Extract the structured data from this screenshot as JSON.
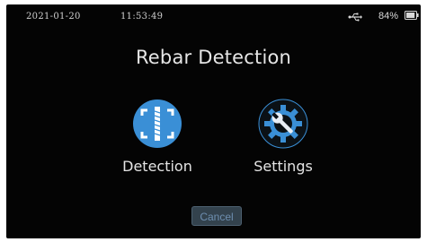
{
  "status_bar": {
    "date": "2021-01-20",
    "time": "11:53:49",
    "battery_percent": "84%",
    "usb_icon": "usb-icon",
    "battery_icon": "battery-icon",
    "battery_level": 0.84
  },
  "main": {
    "title": "Rebar Detection",
    "items": [
      {
        "label": "Detection",
        "icon": "rebar-scan-icon",
        "color": "#3a8fd6"
      },
      {
        "label": "Settings",
        "icon": "gear-wrench-icon",
        "color": "#3a8fd6"
      }
    ]
  },
  "footer": {
    "cancel_label": "Cancel"
  },
  "colors": {
    "screen_background": "#040404",
    "accent": "#3a8fd6",
    "cancel_bg": "#33424d",
    "cancel_text": "#6e8fb0"
  }
}
